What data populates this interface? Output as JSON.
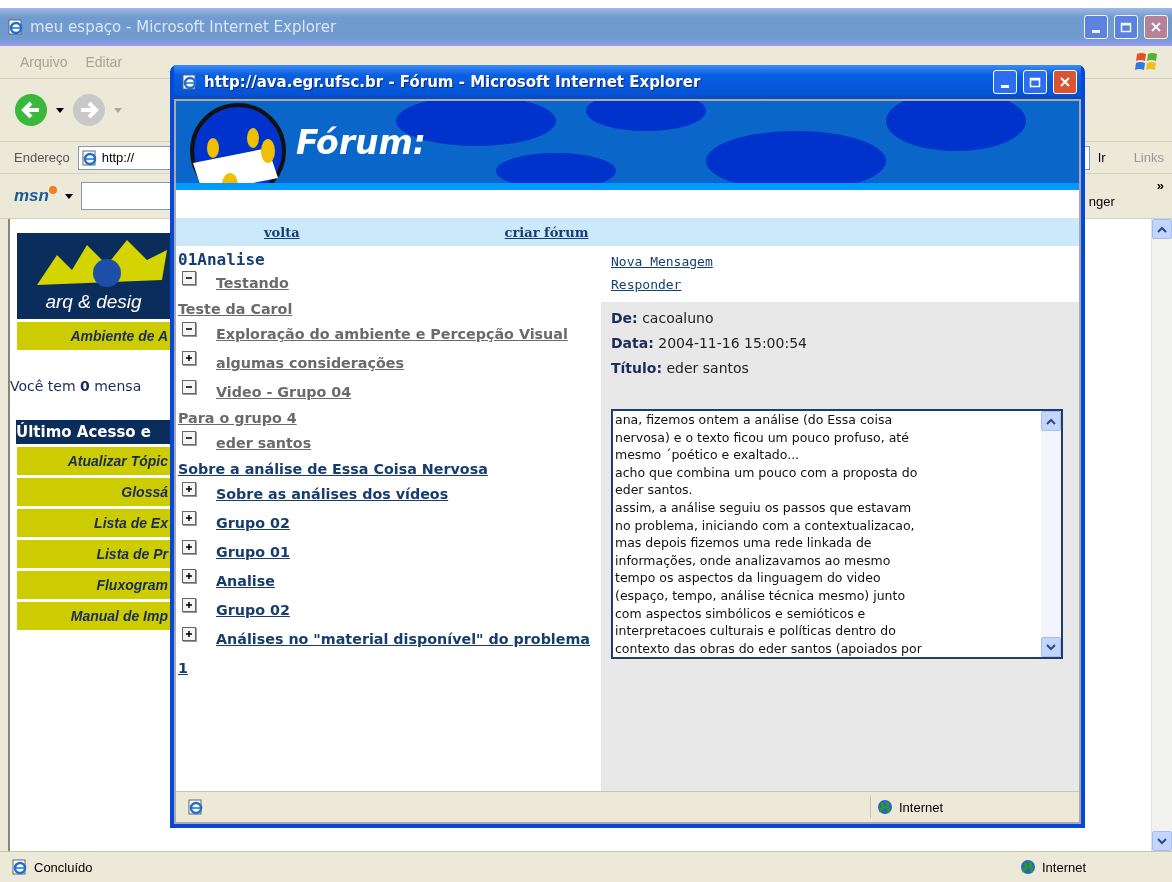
{
  "main_window": {
    "title": "meu espaço - Microsoft Internet Explorer",
    "menu": [
      "Arquivo",
      "Editar"
    ],
    "address_label": "Endereço",
    "address": "http://",
    "go": "Ir",
    "links": "Links",
    "msn": "msn",
    "toolbar_cut": "nger",
    "chevron": "»",
    "page": {
      "logo_text": "arq & desig",
      "banner": "Ambiente de A",
      "messages": "Você tem **0** mensa",
      "last_access": "Último Acesso e",
      "menu": [
        "Atualizar Tópic",
        "Glossá",
        "Lista de Ex",
        "Lista de Pr",
        "Fluxogram",
        "Manual de Imp"
      ]
    },
    "status": {
      "text": "Concluído",
      "zone": "Internet"
    }
  },
  "popup": {
    "title": "http://ava.egr.ufsc.br - Fórum - Microsoft Internet Explorer",
    "banner_title": "Fórum:",
    "nav": [
      "volta",
      "criar fórum"
    ],
    "forum_title": "01Analise",
    "threads": [
      {
        "title": "Testando",
        "expanded": true,
        "visited": true,
        "children": [
          {
            "title": "Teste da Carol",
            "visited": true
          }
        ]
      },
      {
        "title": "Exploração do ambiente e Percepção Visual",
        "expanded": true,
        "visited": true
      },
      {
        "title": "algumas considerações",
        "expanded": false,
        "visited": true
      },
      {
        "title": "Video - Grupo 04",
        "expanded": true,
        "visited": true,
        "children": [
          {
            "title": "Para o grupo 4",
            "visited": true
          }
        ]
      },
      {
        "title": "eder santos",
        "expanded": true,
        "visited": true,
        "children": [
          {
            "title": "Sobre a análise de Essa Coisa Nervosa",
            "visited": false
          }
        ]
      },
      {
        "title": "Sobre as análises dos vídeos",
        "expanded": false,
        "visited": false
      },
      {
        "title": "Grupo 02",
        "expanded": false,
        "visited": false
      },
      {
        "title": "Grupo 01",
        "expanded": false,
        "visited": false
      },
      {
        "title": "Analise",
        "expanded": false,
        "visited": false
      },
      {
        "title": "Grupo 02",
        "expanded": false,
        "visited": false
      },
      {
        "title": "Análises no \"material disponível\" do problema 1",
        "expanded": false,
        "visited": false
      }
    ],
    "actions": [
      "Nova Mensagem",
      "Responder"
    ],
    "message": {
      "fields": [
        {
          "label": "De:",
          "value": "cacoaluno"
        },
        {
          "label": "Data:",
          "value": "2004-11-16 15:00:54"
        },
        {
          "label": "Título:",
          "value": "eder santos"
        }
      ],
      "lines": [
        "ana, fizemos ontem a análise (do Essa coisa",
        "nervosa) e o texto ficou um pouco profuso, até",
        "mesmo ´poético e exaltado...",
        "acho que combina um pouco com a proposta do",
        "eder santos.",
        "assim, a análise seguiu os passos que estavam",
        "no problema, iniciando com a contextualizacao,",
        "mas depois fizemos uma rede linkada de",
        "informações, onde analizavamos ao mesmo",
        "tempo os aspectos da linguagem do video",
        "(espaço, tempo, análise técnica mesmo) junto",
        "com aspectos simbólicos e semióticos e",
        "interpretacoes culturais e políticas dentro do",
        "contexto das obras do eder santos (apoiados por"
      ]
    },
    "status": {
      "zone": "Internet"
    }
  }
}
